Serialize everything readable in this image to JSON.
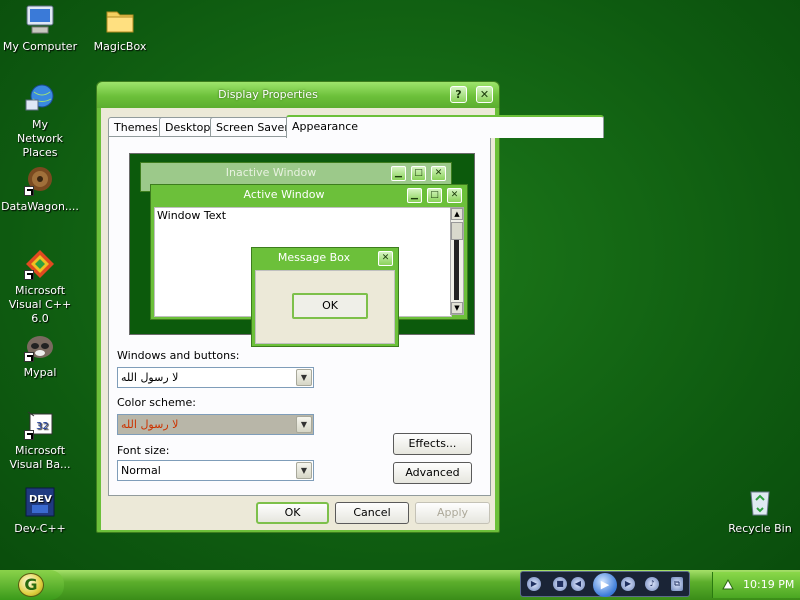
{
  "desktop": {
    "icons": [
      {
        "label": "My Computer"
      },
      {
        "label": "MagicBox"
      },
      {
        "label": "My Network Places"
      },
      {
        "label": "DataWagon...."
      },
      {
        "label": "Microsoft Visual C++ 6.0"
      },
      {
        "label": "Mypal"
      },
      {
        "label": "Microsoft Visual Ba..."
      },
      {
        "label": "Dev-C++"
      },
      {
        "label": "Recycle Bin"
      }
    ]
  },
  "dialog": {
    "title": "Display Properties",
    "help_glyph": "?",
    "close_glyph": "✕",
    "tabs": [
      {
        "label": "Themes"
      },
      {
        "label": "Desktop"
      },
      {
        "label": "Screen Saver"
      },
      {
        "label": "Appearance"
      }
    ],
    "active_tab": "Appearance",
    "preview": {
      "inactive_title": "Inactive Window",
      "active_title": "Active Window",
      "window_text": "Window Text",
      "message_box_title": "Message Box",
      "ok_label": "OK"
    },
    "windows_buttons_label": "Windows and buttons:",
    "windows_buttons_value": "لا رسول الله",
    "color_scheme_label": "Color scheme:",
    "color_scheme_value": "لا رسول الله",
    "font_size_label": "Font size:",
    "font_size_value": "Normal",
    "effects_label": "Effects...",
    "advanced_label": "Advanced",
    "ok_label": "OK",
    "cancel_label": "Cancel",
    "apply_label": "Apply"
  },
  "taskbar": {
    "clock": "10:19 PM"
  },
  "colors": {
    "accent": "#6cc03a",
    "desktop": "#0f5f10",
    "scheme_text": "#cc3300"
  }
}
